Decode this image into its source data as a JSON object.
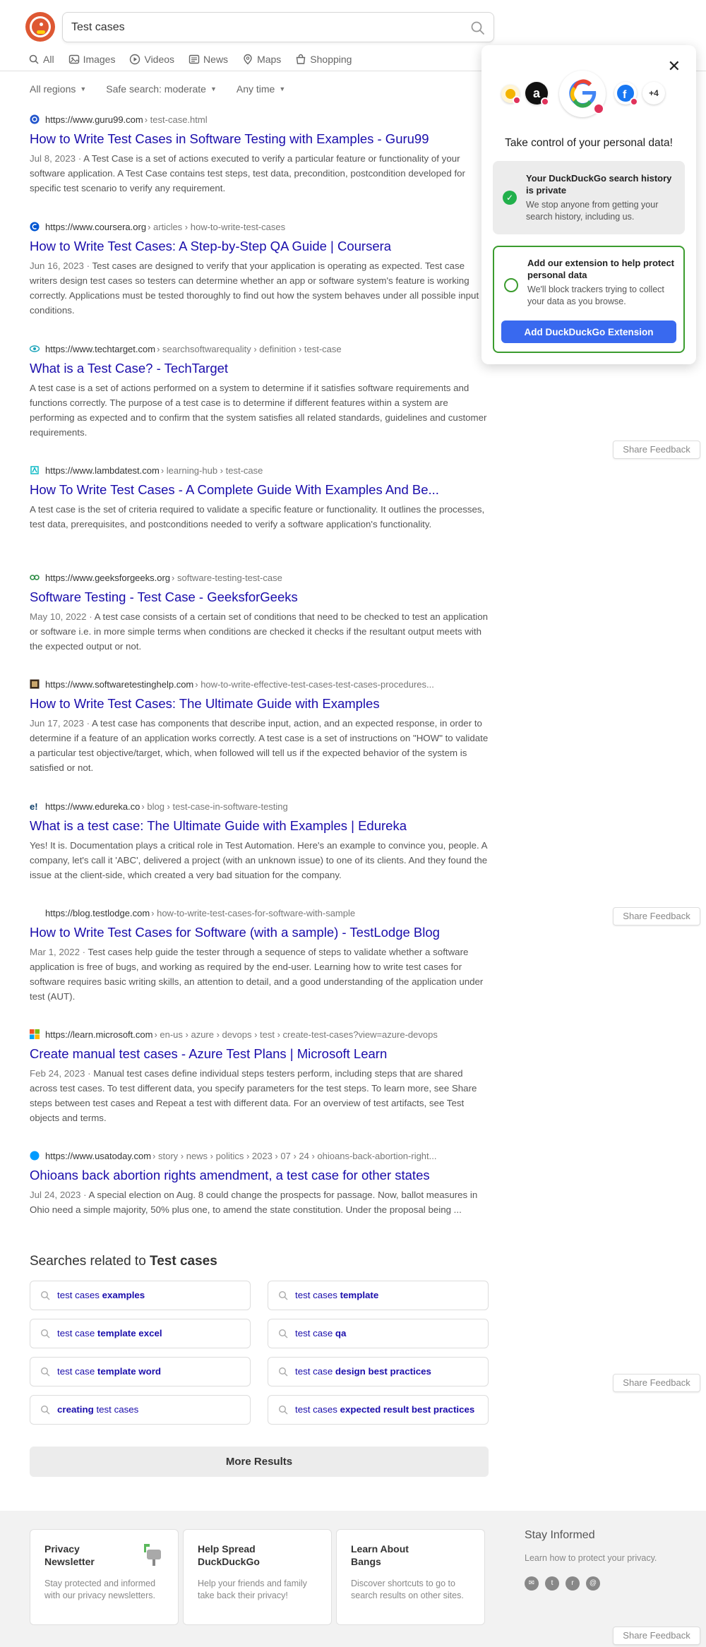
{
  "search": {
    "query": "Test cases"
  },
  "nav": [
    {
      "label": "All",
      "icon": "search-icon"
    },
    {
      "label": "Images",
      "icon": "image-icon"
    },
    {
      "label": "Videos",
      "icon": "play-icon"
    },
    {
      "label": "News",
      "icon": "newspaper-icon"
    },
    {
      "label": "Maps",
      "icon": "map-pin-icon"
    },
    {
      "label": "Shopping",
      "icon": "shopping-bag-icon"
    }
  ],
  "filters": {
    "region": "All regions",
    "safe_search": "Safe search: moderate",
    "time": "Any time"
  },
  "results": [
    {
      "domain": "https://www.guru99.com",
      "path": "› test-case.html",
      "title": "How to Write Test Cases in Software Testing with Examples - Guru99",
      "date": "Jul 8, 2023",
      "snippet": "A Test Case is a set of actions executed to verify a particular feature or functionality of your software application. A Test Case contains test steps, test data, precondition, postcondition developed for specific test scenario to verify any requirement."
    },
    {
      "domain": "https://www.coursera.org",
      "path": "› articles › how-to-write-test-cases",
      "title": "How to Write Test Cases: A Step-by-Step QA Guide | Coursera",
      "date": "Jun 16, 2023",
      "snippet": "Test cases are designed to verify that your application is operating as expected. Test case writers design test cases so testers can determine whether an app or software system's feature is working correctly. Applications must be tested thoroughly to find out how the system behaves under all possible input conditions."
    },
    {
      "domain": "https://www.techtarget.com",
      "path": "› searchsoftwarequality › definition › test-case",
      "title": "What is a Test Case? - TechTarget",
      "date": "",
      "snippet": "A test case is a set of actions performed on a system to determine if it satisfies software requirements and functions correctly. The purpose of a test case is to determine if different features within a system are performing as expected and to confirm that the system satisfies all related standards, guidelines and customer requirements."
    },
    {
      "domain": "https://www.lambdatest.com",
      "path": "› learning-hub › test-case",
      "title": "How To Write Test Cases - A Complete Guide With Examples And Be...",
      "date": "",
      "snippet": "A test case is the set of criteria required to validate a specific feature or functionality. It outlines the processes, test data, prerequisites, and postconditions needed to verify a software application's functionality."
    },
    {
      "domain": "https://www.geeksforgeeks.org",
      "path": "› software-testing-test-case",
      "title": "Software Testing - Test Case - GeeksforGeeks",
      "date": "May 10, 2022",
      "snippet": "A test case consists of a certain set of conditions that need to be checked to test an application or software i.e. in more simple terms when conditions are checked it checks if the resultant output meets with the expected output or not."
    },
    {
      "domain": "https://www.softwaretestinghelp.com",
      "path": "› how-to-write-effective-test-cases-test-cases-procedures...",
      "title": "How to Write Test Cases: The Ultimate Guide with Examples",
      "date": "Jun 17, 2023",
      "snippet": "A test case has components that describe input, action, and an expected response, in order to determine if a feature of an application works correctly. A test case is a set of instructions on \"HOW\" to validate a particular test objective/target, which, when followed will tell us if the expected behavior of the system is satisfied or not."
    },
    {
      "domain": "https://www.edureka.co",
      "path": "› blog › test-case-in-software-testing",
      "title": "What is a test case: The Ultimate Guide with Examples | Edureka",
      "date": "",
      "snippet": "Yes! It is. Documentation plays a critical role in Test Automation. Here's an example to convince you, people. A company, let's call it 'ABC', delivered a project (with an unknown issue) to one of its clients. And they found the issue at the client-side, which created a very bad situation for the company."
    },
    {
      "domain": "https://blog.testlodge.com",
      "path": "› how-to-write-test-cases-for-software-with-sample",
      "title": "How to Write Test Cases for Software (with a sample) - TestLodge Blog",
      "date": "Mar 1, 2022",
      "snippet": "Test cases help guide the tester through a sequence of steps to validate whether a software application is free of bugs, and working as required by the end-user. Learning how to write test cases for software requires basic writing skills, an attention to detail, and a good understanding of the application under test (AUT)."
    },
    {
      "domain": "https://learn.microsoft.com",
      "path": "› en-us › azure › devops › test › create-test-cases?view=azure-devops",
      "title": "Create manual test cases - Azure Test Plans | Microsoft Learn",
      "date": "Feb 24, 2023",
      "snippet": "Manual test cases define individual steps testers perform, including steps that are shared across test cases. To test different data, you specify parameters for the test steps. To learn more, see Share steps between test cases and Repeat a test with different data. For an overview of test artifacts, see Test objects and terms."
    },
    {
      "domain": "https://www.usatoday.com",
      "path": "› story › news › politics › 2023 › 07 › 24 › ohioans-back-abortion-right...",
      "title": "Ohioans back abortion rights amendment, a test case for other states",
      "date": "Jul 24, 2023",
      "snippet": "A special election on Aug. 8 could change the prospects for passage. Now, ballot measures in Ohio need a simple majority, 50% plus one, to amend the state constitution. Under the proposal being ..."
    }
  ],
  "share_feedback": "Share Feedback",
  "related": {
    "heading_prefix": "Searches related to",
    "heading_query": "Test cases",
    "items": [
      {
        "plain": "test cases",
        "bold": "examples"
      },
      {
        "plain": "test cases",
        "bold": "template"
      },
      {
        "plain": "test case",
        "bold": "template excel"
      },
      {
        "plain": "test case",
        "bold": "qa"
      },
      {
        "plain": "test case",
        "bold": "template word"
      },
      {
        "plain": "test case",
        "bold": "design best practices"
      },
      {
        "plain": "test cases",
        "bold": "creating"
      },
      {
        "plain": "test cases",
        "bold": "expected result best practices"
      }
    ]
  },
  "more_results": "More Results",
  "footer": {
    "cards": [
      {
        "title": "Privacy Newsletter",
        "desc": "Stay protected and informed with our privacy newsletters."
      },
      {
        "title": "Help Spread DuckDuckGo",
        "desc": "Help your friends and family take back their privacy!"
      },
      {
        "title": "Learn About Bangs",
        "desc": "Discover shortcuts to go to search results on other sites."
      }
    ],
    "stay_title": "Stay Informed",
    "stay_desc": "Learn how to protect your privacy."
  },
  "popup": {
    "heading": "Take control of your personal data!",
    "tracker_more": "+4",
    "box1_title": "Your DuckDuckGo search history is private",
    "box1_desc": "We stop anyone from getting your search history, including us.",
    "box2_title": "Add our extension to help protect personal data",
    "box2_desc": "We'll block trackers trying to collect your data as you browse.",
    "button": "Add DuckDuckGo Extension"
  },
  "colors": {
    "link": "#1a0dab",
    "accent": "#de5833",
    "button_blue": "#3969ef",
    "green": "#3b9c2e"
  }
}
